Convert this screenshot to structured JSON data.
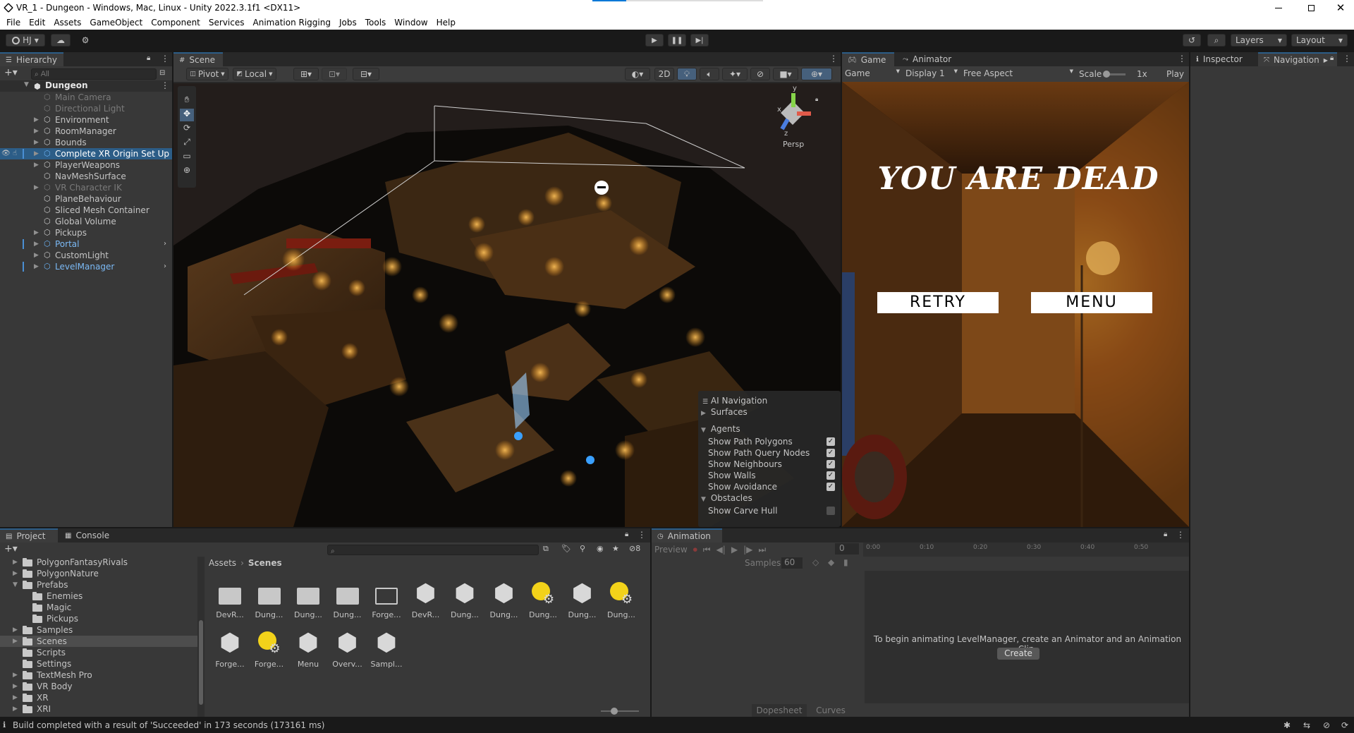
{
  "window": {
    "title": "VR_1 - Dungeon - Windows, Mac, Linux - Unity 2022.3.1f1 <DX11>"
  },
  "menu": [
    "File",
    "Edit",
    "Assets",
    "GameObject",
    "Component",
    "Services",
    "Animation Rigging",
    "Jobs",
    "Tools",
    "Window",
    "Help"
  ],
  "toolbar": {
    "account": "HJ",
    "layers": "Layers",
    "layout": "Layout"
  },
  "hierarchy": {
    "tab": "Hierarchy",
    "search_placeholder": "All",
    "scene": "Dungeon",
    "items": [
      {
        "label": "Main Camera",
        "style": "dim",
        "arrow": false
      },
      {
        "label": "Directional Light",
        "style": "dim",
        "arrow": false
      },
      {
        "label": "Environment",
        "style": "normal",
        "arrow": true
      },
      {
        "label": "RoomManager",
        "style": "normal",
        "arrow": true
      },
      {
        "label": "Bounds",
        "style": "normal",
        "arrow": true
      },
      {
        "label": "Complete XR Origin Set Up",
        "style": "selected",
        "arrow": true
      },
      {
        "label": "PlayerWeapons",
        "style": "normal",
        "arrow": true
      },
      {
        "label": "NavMeshSurface",
        "style": "normal",
        "arrow": false
      },
      {
        "label": "VR Character IK",
        "style": "dim",
        "arrow": true
      },
      {
        "label": "PlaneBehaviour",
        "style": "normal",
        "arrow": false
      },
      {
        "label": "Sliced Mesh Container",
        "style": "normal",
        "arrow": false
      },
      {
        "label": "Global Volume",
        "style": "normal",
        "arrow": false
      },
      {
        "label": "Pickups",
        "style": "normal",
        "arrow": true
      },
      {
        "label": "Portal",
        "style": "prefab",
        "arrow": true
      },
      {
        "label": "CustomLight",
        "style": "normal",
        "arrow": true
      },
      {
        "label": "LevelManager",
        "style": "prefab",
        "arrow": true
      }
    ]
  },
  "scene_view": {
    "tab": "Scene",
    "pivot": "Pivot",
    "local": "Local",
    "mode_2d": "2D",
    "persp": "Persp",
    "gizmo_axes": {
      "x": "x",
      "y": "y",
      "z": "z"
    }
  },
  "ai_navigation": {
    "title": "AI Navigation",
    "surfaces": "Surfaces",
    "agents": "Agents",
    "options": [
      {
        "label": "Show Path Polygons",
        "checked": true
      },
      {
        "label": "Show Path Query Nodes",
        "checked": true
      },
      {
        "label": "Show Neighbours",
        "checked": true
      },
      {
        "label": "Show Walls",
        "checked": true
      },
      {
        "label": "Show Avoidance",
        "checked": true
      }
    ],
    "obstacles": "Obstacles",
    "obstacle_options": [
      {
        "label": "Show Carve Hull",
        "checked": false
      }
    ]
  },
  "game_view": {
    "tabs": [
      "Game",
      "Animator"
    ],
    "game_dropdown": "Game",
    "display": "Display 1",
    "aspect": "Free Aspect",
    "scale_label": "Scale",
    "scale_value": "1x",
    "play_label": "Play",
    "headline": "YOU ARE DEAD",
    "retry": "RETRY",
    "menu": "MENU"
  },
  "inspector": {
    "tabs": [
      "Inspector",
      "Navigation"
    ]
  },
  "project": {
    "tabs": [
      "Project",
      "Console"
    ],
    "tree": [
      {
        "label": "PolygonFantasyRivals",
        "indent": 0,
        "arrow": "right"
      },
      {
        "label": "PolygonNature",
        "indent": 0,
        "arrow": "right"
      },
      {
        "label": "Prefabs",
        "indent": 0,
        "arrow": "down"
      },
      {
        "label": "Enemies",
        "indent": 1,
        "arrow": ""
      },
      {
        "label": "Magic",
        "indent": 1,
        "arrow": ""
      },
      {
        "label": "Pickups",
        "indent": 1,
        "arrow": ""
      },
      {
        "label": "Samples",
        "indent": 0,
        "arrow": "right"
      },
      {
        "label": "Scenes",
        "indent": 0,
        "arrow": "right",
        "selected": true
      },
      {
        "label": "Scripts",
        "indent": 0,
        "arrow": ""
      },
      {
        "label": "Settings",
        "indent": 0,
        "arrow": ""
      },
      {
        "label": "TextMesh Pro",
        "indent": 0,
        "arrow": "right"
      },
      {
        "label": "VR Body",
        "indent": 0,
        "arrow": "right"
      },
      {
        "label": "XR",
        "indent": 0,
        "arrow": "right"
      },
      {
        "label": "XRI",
        "indent": 0,
        "arrow": "right"
      }
    ],
    "breadcrumb": [
      "Assets",
      "Scenes"
    ],
    "hidden_count": "8",
    "assets": [
      {
        "label": "DevR...",
        "type": "folder"
      },
      {
        "label": "Dung...",
        "type": "folder"
      },
      {
        "label": "Dung...",
        "type": "folder"
      },
      {
        "label": "Dung...",
        "type": "folder"
      },
      {
        "label": "Forge...",
        "type": "folder-empty"
      },
      {
        "label": "DevR...",
        "type": "scene"
      },
      {
        "label": "Dung...",
        "type": "scene"
      },
      {
        "label": "Dung...",
        "type": "scene"
      },
      {
        "label": "Dung...",
        "type": "lighting"
      },
      {
        "label": "Dung...",
        "type": "scene"
      },
      {
        "label": "Dung...",
        "type": "lighting"
      },
      {
        "label": "Forge...",
        "type": "scene"
      },
      {
        "label": "Forge...",
        "type": "lighting"
      },
      {
        "label": "Menu",
        "type": "scene"
      },
      {
        "label": "Overv...",
        "type": "scene"
      },
      {
        "label": "Sampl...",
        "type": "scene"
      }
    ]
  },
  "animation": {
    "tab": "Animation",
    "preview": "Preview",
    "frame": "0",
    "samples_label": "Samples",
    "samples_value": "60",
    "ticks": [
      "0:00",
      "0:10",
      "0:20",
      "0:30",
      "0:40",
      "0:50"
    ],
    "message": "To begin animating LevelManager, create an Animator and an Animation Clip.",
    "create": "Create",
    "bottom_tabs": [
      "Dopesheet",
      "Curves"
    ]
  },
  "status": {
    "text": "Build completed with a result of 'Succeeded' in 173 seconds (173161 ms)"
  }
}
